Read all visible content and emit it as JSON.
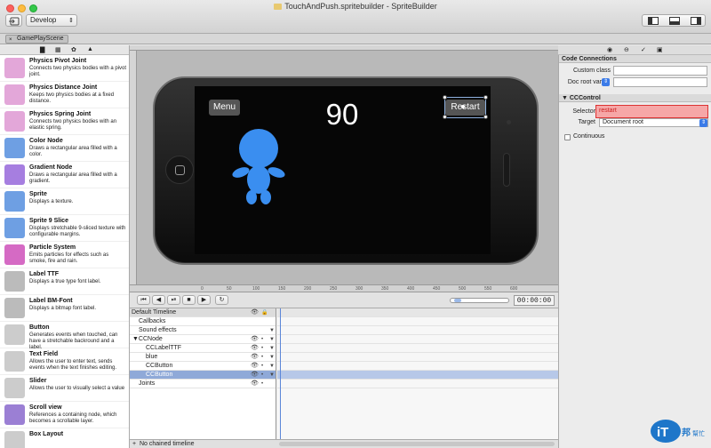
{
  "window": {
    "title": "TouchAndPush.spritebuilder - SpriteBuilder",
    "traffic_colors": {
      "close": "#fc615d",
      "minimize": "#fdbc40",
      "zoom": "#34c84a"
    }
  },
  "toolbar": {
    "scheme": "Develop"
  },
  "tabs": [
    {
      "label": "GamePlayScene"
    }
  ],
  "library": {
    "items": [
      {
        "name": "Physics Pivot Joint",
        "desc": "Connects two physics bodies with a pivot joint.",
        "icon": "pivot-joint-icon",
        "color": "#e3a7d9"
      },
      {
        "name": "Physics Distance Joint",
        "desc": "Keeps two physics bodies at a fixed distance.",
        "icon": "distance-joint-icon",
        "color": "#e3a7d9"
      },
      {
        "name": "Physics Spring Joint",
        "desc": "Connects two physics bodies with an elastic spring.",
        "icon": "spring-joint-icon",
        "color": "#e3a7d9"
      },
      {
        "name": "Color Node",
        "desc": "Draws a rectangular area filled with a color.",
        "icon": "color-node-icon",
        "color": "#6e9fe3"
      },
      {
        "name": "Gradient Node",
        "desc": "Draws a rectangular area filled with a gradient.",
        "icon": "gradient-node-icon",
        "color": "#a67ee0"
      },
      {
        "name": "Sprite",
        "desc": "Displays a texture.",
        "icon": "sprite-icon",
        "color": "#6e9fe3"
      },
      {
        "name": "Sprite 9 Slice",
        "desc": "Displays stretchable 9-sliced texture with configurable margins.",
        "icon": "sprite-9-slice-icon",
        "color": "#6e9fe3"
      },
      {
        "name": "Particle System",
        "desc": "Emits particles for effects such as smoke, fire and rain.",
        "icon": "particle-system-icon",
        "color": "#d56ac4"
      },
      {
        "name": "Label TTF",
        "desc": "Displays a true type font label.",
        "icon": "label-ttf-icon",
        "color": "#bbbbbb"
      },
      {
        "name": "Label BM-Font",
        "desc": "Displays a bitmap font label.",
        "icon": "label-bmfont-icon",
        "color": "#bbbbbb"
      },
      {
        "name": "Button",
        "desc": "Generates events when touched, can have a stretchable backround and a label.",
        "icon": "button-icon",
        "color": "#cccccc"
      },
      {
        "name": "Text Field",
        "desc": "Allows the user to enter text, sends events when the text finishes editing.",
        "icon": "text-field-icon",
        "color": "#cccccc"
      },
      {
        "name": "Slider",
        "desc": "Allows the user to visually select a value",
        "icon": "slider-icon",
        "color": "#cccccc"
      },
      {
        "name": "Scroll view",
        "desc": "References a containing node, which becomes a scrollable layer.",
        "icon": "scroll-view-icon",
        "color": "#9b7fd4"
      },
      {
        "name": "Box Layout",
        "desc": "",
        "icon": "box-layout-icon",
        "color": "#cccccc"
      }
    ]
  },
  "canvas": {
    "menu_label": "Menu",
    "restart_label": "Restart",
    "score": "90",
    "character_color": "#3a8ef0",
    "ruler_ticks": [
      "0",
      "50",
      "100",
      "150",
      "200",
      "250",
      "300",
      "350",
      "400",
      "450",
      "500",
      "550",
      "600"
    ]
  },
  "timeline": {
    "time": "00:00:00",
    "rows": [
      {
        "label": "Default Timeline",
        "indent": 2,
        "type": "header"
      },
      {
        "label": "Callbacks",
        "indent": 10,
        "type": "plain"
      },
      {
        "label": "Sound effects",
        "indent": 10,
        "type": "plain",
        "tri": "▼"
      },
      {
        "label": "▼CCNode",
        "indent": 3,
        "type": "node"
      },
      {
        "label": "CCLabelTTF",
        "indent": 18,
        "type": "node"
      },
      {
        "label": "blue",
        "indent": 18,
        "type": "node"
      },
      {
        "label": "CCButton",
        "indent": 18,
        "type": "node"
      },
      {
        "label": "CCButton",
        "indent": 18,
        "type": "selected"
      },
      {
        "label": "Joints",
        "indent": 10,
        "type": "joint"
      }
    ],
    "footer": "No chained timeline"
  },
  "inspector": {
    "code_connections": {
      "title": "Code Connections",
      "custom_class_label": "Custom class",
      "custom_class_value": "",
      "doc_root_var_label": "Doc root var",
      "doc_root_var_value": ""
    },
    "cccontrol": {
      "title": "CCControl",
      "selector_label": "Selector",
      "selector_value": "restart",
      "target_label": "Target",
      "target_value": "Document root",
      "continuous_label": "Continuous"
    }
  }
}
